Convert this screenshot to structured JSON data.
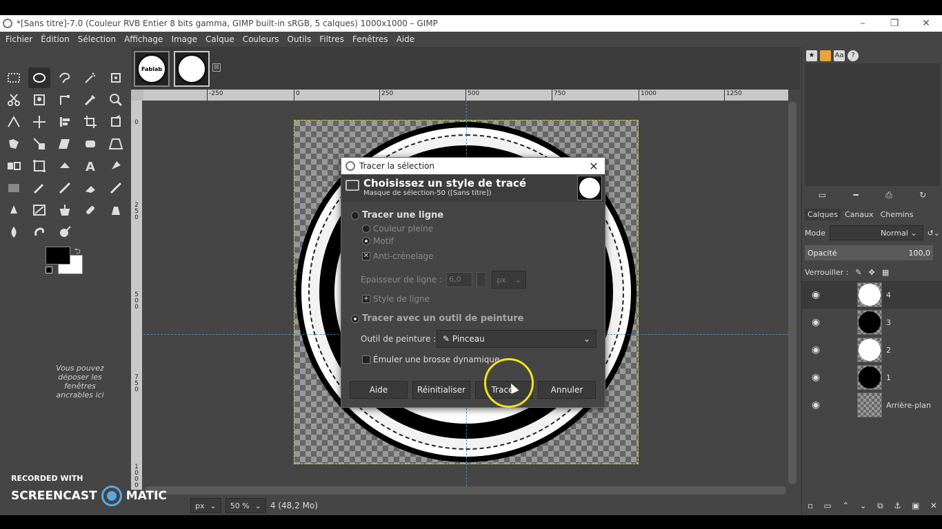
{
  "window": {
    "title": "*[Sans titre]-7.0 (Couleur RVB Entier 8 bits gamma, GIMP built-in sRGB, 5 calques) 1000x1000 – GIMP",
    "minimize": "–",
    "restore": "❐",
    "close": "✕"
  },
  "menu": {
    "items": [
      "Fichier",
      "Édition",
      "Sélection",
      "Affichage",
      "Image",
      "Calque",
      "Couleurs",
      "Outils",
      "Filtres",
      "Fenêtres",
      "Aide"
    ]
  },
  "toolbox": {
    "dock_hint": "Vous pouvez déposer les fenêtres ancrables ici"
  },
  "tabs": {
    "thumb1_label": "Fablab",
    "close_icon": "⊠"
  },
  "ruler": {
    "h_ticks": [
      "-250",
      "0",
      "250",
      "500",
      "750",
      "1000",
      "1250"
    ],
    "v_ticks": [
      "0",
      "2 5 0",
      "5 0 0",
      "7 5 0",
      "1 0 0 0"
    ]
  },
  "statusbar": {
    "unit": "px",
    "zoom": "50 %",
    "info": "4 (48,2 Mo)"
  },
  "dock": {
    "layer_tabs": [
      "Calques",
      "Canaux",
      "Chemins"
    ],
    "mode_label": "Mode",
    "mode_value": "Normal",
    "opacity_label": "Opacité",
    "opacity_value": "100,0",
    "lock_label": "Verrouiller :",
    "layers": [
      {
        "name": "4",
        "color": "#ffffff"
      },
      {
        "name": "3",
        "color": "#000000"
      },
      {
        "name": "2",
        "color": "#ffffff"
      },
      {
        "name": "1",
        "color": "#000000"
      },
      {
        "name": "Arrière-plan",
        "color": "transparent"
      }
    ]
  },
  "dialog": {
    "title": "Tracer la sélection",
    "header_title": "Choisissez un style de tracé",
    "header_subtitle": "Masque de sélection-50 ([Sans titre])",
    "opt_line": "Tracer une ligne",
    "opt_solid": "Couleur pleine",
    "opt_pattern": "Motif",
    "opt_antialias": "Anti-crénelage",
    "line_width_label": "Épaisseur de ligne :",
    "line_width_value": "6,0",
    "unit": "px",
    "line_style": "Style de ligne",
    "opt_paint_tool": "Tracer avec un outil de peinture",
    "paint_tool_label": "Outil de peinture :",
    "paint_tool_value": "Pinceau",
    "emulate_dynamics": "Émuler une brosse dynamique",
    "btn_help": "Aide",
    "btn_reset": "Réinitialiser",
    "btn_stroke": "Tracer",
    "btn_cancel": "Annuler"
  },
  "watermark": {
    "small": "RECORDED WITH",
    "brand_left": "SCREENCAST",
    "brand_right": "MATIC"
  },
  "colors": {
    "accent_ring": "#f4e31a",
    "guide": "#4a8aaa"
  }
}
